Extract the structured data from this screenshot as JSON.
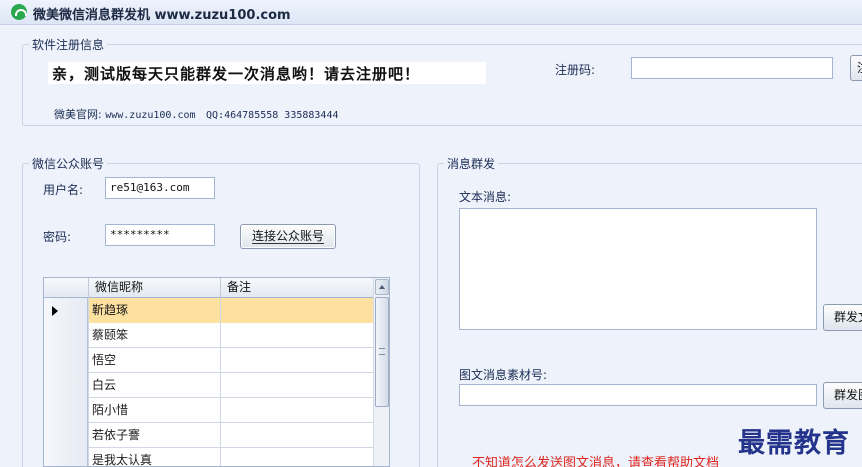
{
  "window": {
    "title": "微美微信消息群发机 www.zuzu100.com"
  },
  "registration": {
    "group_title": "软件注册信息",
    "notice": "亲，测试版每天只能群发一次消息哟！请去注册吧！",
    "code_label": "注册码:",
    "code_value": "",
    "register_button": "注册",
    "site_label": "微美官网:",
    "site_url": "www.zuzu100.com",
    "qq_label": "QQ:",
    "qq_numbers": "464785558  335883444"
  },
  "account": {
    "group_title": "微信公众账号",
    "username_label": "用户名:",
    "username_value": "re51@163.com",
    "password_label": "密码:",
    "password_value": "*********",
    "connect_button": "连接公众账号",
    "table": {
      "columns": [
        "微信昵称",
        "备注"
      ],
      "rows": [
        {
          "nickname": "靳趋琢",
          "note": "",
          "selected": true
        },
        {
          "nickname": "蔡颐笨",
          "note": "",
          "selected": false
        },
        {
          "nickname": "悟空",
          "note": "",
          "selected": false
        },
        {
          "nickname": "白云",
          "note": "",
          "selected": false
        },
        {
          "nickname": "陌小惜",
          "note": "",
          "selected": false
        },
        {
          "nickname": "若依子謇",
          "note": "",
          "selected": false
        },
        {
          "nickname": "是我太认真",
          "note": "",
          "selected": false
        }
      ]
    }
  },
  "messaging": {
    "group_title": "消息群发",
    "text_label": "文本消息:",
    "text_value": "",
    "send_text_button": "群发文本",
    "media_label": "图文消息素材号:",
    "media_value": "",
    "send_media_button": "群发图文",
    "help_link": "不知道怎么发送图文消息，请查看帮助文档"
  },
  "watermark": "最需教育"
}
